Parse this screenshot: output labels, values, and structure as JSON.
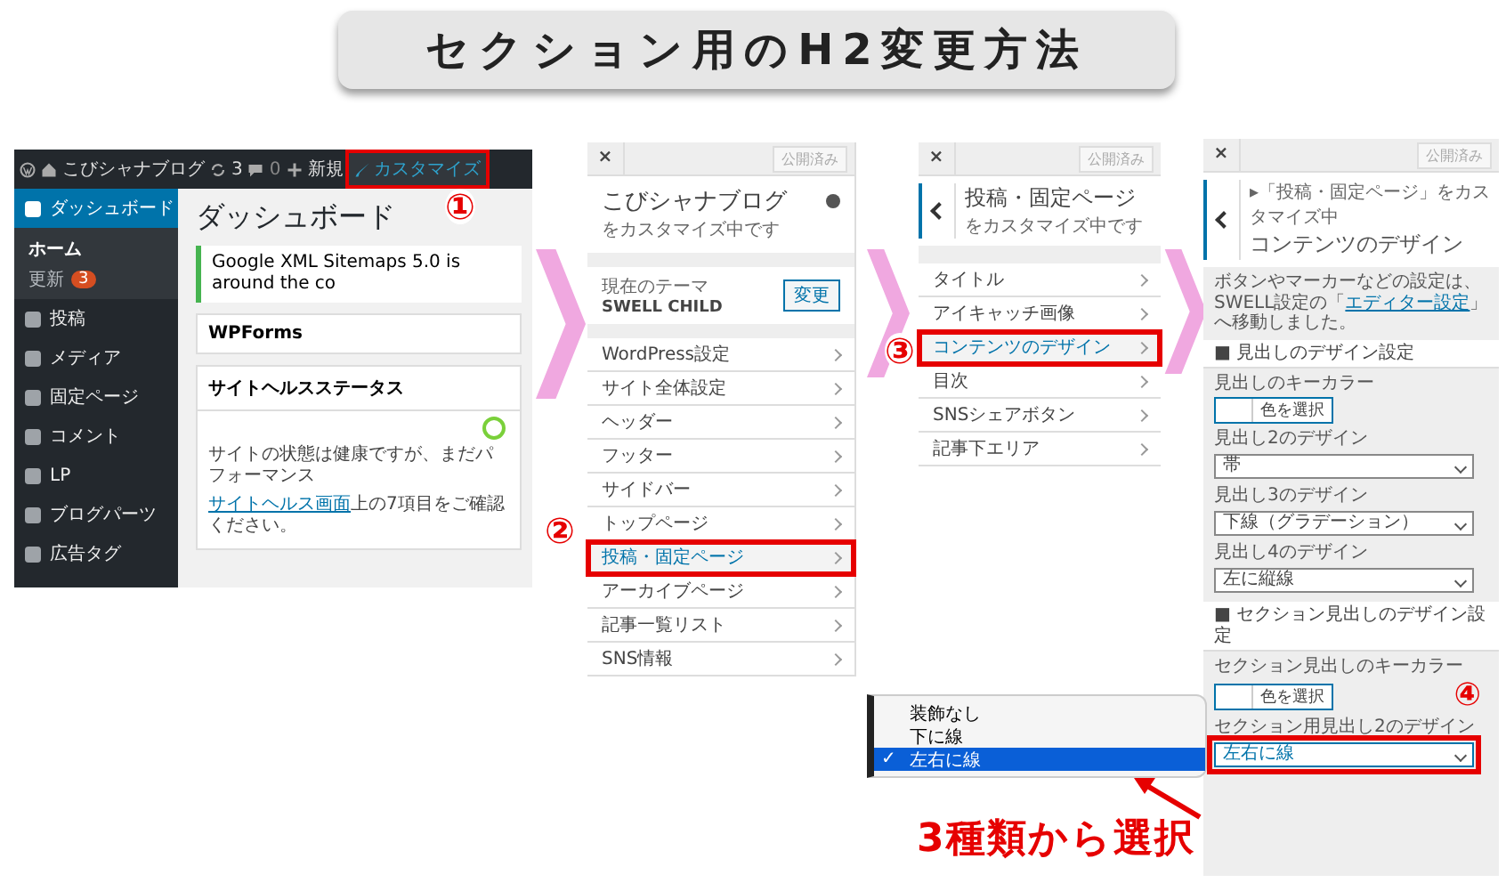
{
  "banner": {
    "title": "セクション用のH2変更方法"
  },
  "admin": {
    "topbar": {
      "site": "こびシャナブログ",
      "updates": "3",
      "comments": "0",
      "new": "新規",
      "customize": "カスタマイズ",
      "customize_highlighted": true
    },
    "sidebar": [
      {
        "label": "ダッシュボード",
        "selected": true,
        "children": [
          {
            "label": "ホーム",
            "selected": true
          },
          {
            "label": "更新",
            "selected": false,
            "badge": "3"
          }
        ]
      },
      {
        "label": "投稿",
        "selected": false
      },
      {
        "label": "メディア",
        "selected": false
      },
      {
        "label": "固定ページ",
        "selected": false
      },
      {
        "label": "コメント",
        "selected": false
      },
      {
        "label": "LP",
        "selected": false
      },
      {
        "label": "ブログパーツ",
        "selected": false
      },
      {
        "label": "広告タグ",
        "selected": false
      }
    ],
    "heading": "ダッシュボード",
    "notice": "Google XML Sitemaps 5.0 is around the co",
    "box_title": "WPForms",
    "health": {
      "title": "サイトヘルスステータス",
      "text": "サイトの状態は健康ですが、まだパフォーマンス",
      "link": "サイトヘルス画面",
      "link_rest": "上の7項目をご確認ください。"
    }
  },
  "customizer_home": {
    "close": "×",
    "publish": "公開済み",
    "title": "こびシャナブログ",
    "subtitle": "をカスタマイズ中です",
    "theme_label": "現在のテーマ",
    "theme": "SWELL CHILD",
    "change": "変更",
    "items": [
      {
        "label": "WordPress設定",
        "selected": false
      },
      {
        "label": "サイト全体設定",
        "selected": false
      },
      {
        "label": "ヘッダー",
        "selected": false
      },
      {
        "label": "フッター",
        "selected": false
      },
      {
        "label": "サイドバー",
        "selected": false
      },
      {
        "label": "トップページ",
        "selected": false
      },
      {
        "label": "投稿・固定ページ",
        "selected": true
      },
      {
        "label": "アーカイブページ",
        "selected": false
      },
      {
        "label": "記事一覧リスト",
        "selected": false
      },
      {
        "label": "SNS情報",
        "selected": false
      }
    ]
  },
  "customizer_posts": {
    "close": "×",
    "publish": "公開済み",
    "title": "投稿・固定ページ",
    "subtitle": "をカスタマイズ中です",
    "items": [
      {
        "label": "タイトル",
        "selected": false
      },
      {
        "label": "アイキャッチ画像",
        "selected": false
      },
      {
        "label": "コンテンツのデザイン",
        "selected": true
      },
      {
        "label": "目次",
        "selected": false
      },
      {
        "label": "SNSシェアボタン",
        "selected": false
      },
      {
        "label": "記事下エリア",
        "selected": false
      }
    ]
  },
  "customizer_design": {
    "close": "×",
    "publish": "公開済み",
    "breadcrumb": "▸「投稿・固定ページ」をカスタマイズ中",
    "title": "コンテンツのデザイン",
    "notice": "ボタンやマーカーなどの設定は、SWELL設定の「",
    "notice_link": "エディター設定",
    "notice_rest": "」へ移動しました。",
    "sections": [
      {
        "title": "■ 見出しのデザイン設定",
        "fields": [
          {
            "kind": "color",
            "label": "見出しのキーカラー",
            "button": "色を選択"
          },
          {
            "kind": "select",
            "label": "見出し2のデザイン",
            "value": "帯",
            "highlighted": false
          },
          {
            "kind": "select",
            "label": "見出し3のデザイン",
            "value": "下線（グラデーション）",
            "highlighted": false
          },
          {
            "kind": "select",
            "label": "見出し4のデザイン",
            "value": "左に縦線",
            "highlighted": false
          }
        ]
      },
      {
        "title": "■ セクション見出しのデザイン設定",
        "fields": [
          {
            "kind": "color",
            "label": "セクション見出しのキーカラー",
            "button": "色を選択"
          },
          {
            "kind": "select",
            "label": "セクション用見出し2のデザイン",
            "value": "左右に線",
            "highlighted": true
          }
        ]
      }
    ]
  },
  "dropdown": {
    "options": [
      {
        "label": "装飾なし",
        "selected": false
      },
      {
        "label": "下に線",
        "selected": false
      },
      {
        "label": "左右に線",
        "selected": true
      }
    ],
    "check": "✓"
  },
  "callout": "3種類から選択",
  "steps": [
    "①",
    "②",
    "③",
    "④"
  ]
}
